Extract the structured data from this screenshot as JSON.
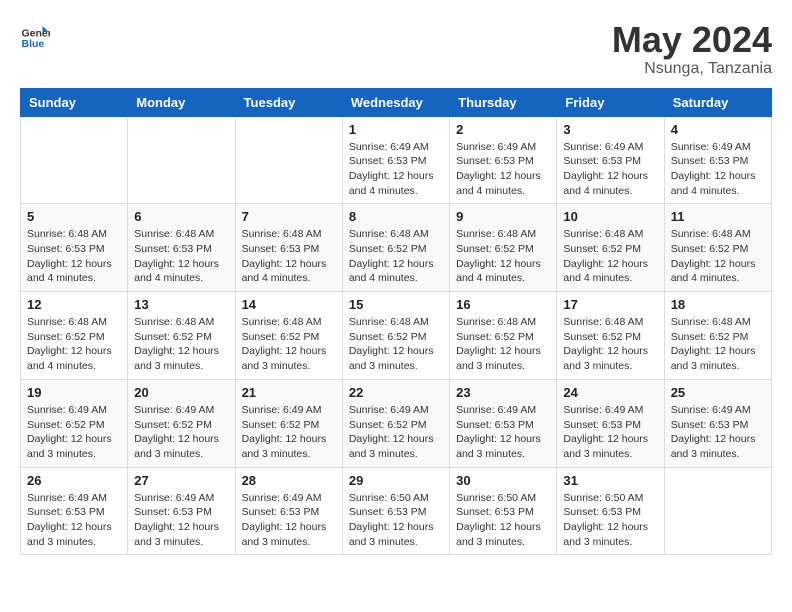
{
  "logo": {
    "general": "General",
    "blue": "Blue"
  },
  "title": {
    "month_year": "May 2024",
    "location": "Nsunga, Tanzania"
  },
  "days_of_week": [
    "Sunday",
    "Monday",
    "Tuesday",
    "Wednesday",
    "Thursday",
    "Friday",
    "Saturday"
  ],
  "weeks": [
    [
      {
        "day": "",
        "info": ""
      },
      {
        "day": "",
        "info": ""
      },
      {
        "day": "",
        "info": ""
      },
      {
        "day": "1",
        "info": "Sunrise: 6:49 AM\nSunset: 6:53 PM\nDaylight: 12 hours\nand 4 minutes."
      },
      {
        "day": "2",
        "info": "Sunrise: 6:49 AM\nSunset: 6:53 PM\nDaylight: 12 hours\nand 4 minutes."
      },
      {
        "day": "3",
        "info": "Sunrise: 6:49 AM\nSunset: 6:53 PM\nDaylight: 12 hours\nand 4 minutes."
      },
      {
        "day": "4",
        "info": "Sunrise: 6:49 AM\nSunset: 6:53 PM\nDaylight: 12 hours\nand 4 minutes."
      }
    ],
    [
      {
        "day": "5",
        "info": "Sunrise: 6:48 AM\nSunset: 6:53 PM\nDaylight: 12 hours\nand 4 minutes."
      },
      {
        "day": "6",
        "info": "Sunrise: 6:48 AM\nSunset: 6:53 PM\nDaylight: 12 hours\nand 4 minutes."
      },
      {
        "day": "7",
        "info": "Sunrise: 6:48 AM\nSunset: 6:53 PM\nDaylight: 12 hours\nand 4 minutes."
      },
      {
        "day": "8",
        "info": "Sunrise: 6:48 AM\nSunset: 6:52 PM\nDaylight: 12 hours\nand 4 minutes."
      },
      {
        "day": "9",
        "info": "Sunrise: 6:48 AM\nSunset: 6:52 PM\nDaylight: 12 hours\nand 4 minutes."
      },
      {
        "day": "10",
        "info": "Sunrise: 6:48 AM\nSunset: 6:52 PM\nDaylight: 12 hours\nand 4 minutes."
      },
      {
        "day": "11",
        "info": "Sunrise: 6:48 AM\nSunset: 6:52 PM\nDaylight: 12 hours\nand 4 minutes."
      }
    ],
    [
      {
        "day": "12",
        "info": "Sunrise: 6:48 AM\nSunset: 6:52 PM\nDaylight: 12 hours\nand 4 minutes."
      },
      {
        "day": "13",
        "info": "Sunrise: 6:48 AM\nSunset: 6:52 PM\nDaylight: 12 hours\nand 3 minutes."
      },
      {
        "day": "14",
        "info": "Sunrise: 6:48 AM\nSunset: 6:52 PM\nDaylight: 12 hours\nand 3 minutes."
      },
      {
        "day": "15",
        "info": "Sunrise: 6:48 AM\nSunset: 6:52 PM\nDaylight: 12 hours\nand 3 minutes."
      },
      {
        "day": "16",
        "info": "Sunrise: 6:48 AM\nSunset: 6:52 PM\nDaylight: 12 hours\nand 3 minutes."
      },
      {
        "day": "17",
        "info": "Sunrise: 6:48 AM\nSunset: 6:52 PM\nDaylight: 12 hours\nand 3 minutes."
      },
      {
        "day": "18",
        "info": "Sunrise: 6:48 AM\nSunset: 6:52 PM\nDaylight: 12 hours\nand 3 minutes."
      }
    ],
    [
      {
        "day": "19",
        "info": "Sunrise: 6:49 AM\nSunset: 6:52 PM\nDaylight: 12 hours\nand 3 minutes."
      },
      {
        "day": "20",
        "info": "Sunrise: 6:49 AM\nSunset: 6:52 PM\nDaylight: 12 hours\nand 3 minutes."
      },
      {
        "day": "21",
        "info": "Sunrise: 6:49 AM\nSunset: 6:52 PM\nDaylight: 12 hours\nand 3 minutes."
      },
      {
        "day": "22",
        "info": "Sunrise: 6:49 AM\nSunset: 6:52 PM\nDaylight: 12 hours\nand 3 minutes."
      },
      {
        "day": "23",
        "info": "Sunrise: 6:49 AM\nSunset: 6:53 PM\nDaylight: 12 hours\nand 3 minutes."
      },
      {
        "day": "24",
        "info": "Sunrise: 6:49 AM\nSunset: 6:53 PM\nDaylight: 12 hours\nand 3 minutes."
      },
      {
        "day": "25",
        "info": "Sunrise: 6:49 AM\nSunset: 6:53 PM\nDaylight: 12 hours\nand 3 minutes."
      }
    ],
    [
      {
        "day": "26",
        "info": "Sunrise: 6:49 AM\nSunset: 6:53 PM\nDaylight: 12 hours\nand 3 minutes."
      },
      {
        "day": "27",
        "info": "Sunrise: 6:49 AM\nSunset: 6:53 PM\nDaylight: 12 hours\nand 3 minutes."
      },
      {
        "day": "28",
        "info": "Sunrise: 6:49 AM\nSunset: 6:53 PM\nDaylight: 12 hours\nand 3 minutes."
      },
      {
        "day": "29",
        "info": "Sunrise: 6:50 AM\nSunset: 6:53 PM\nDaylight: 12 hours\nand 3 minutes."
      },
      {
        "day": "30",
        "info": "Sunrise: 6:50 AM\nSunset: 6:53 PM\nDaylight: 12 hours\nand 3 minutes."
      },
      {
        "day": "31",
        "info": "Sunrise: 6:50 AM\nSunset: 6:53 PM\nDaylight: 12 hours\nand 3 minutes."
      },
      {
        "day": "",
        "info": ""
      }
    ]
  ]
}
